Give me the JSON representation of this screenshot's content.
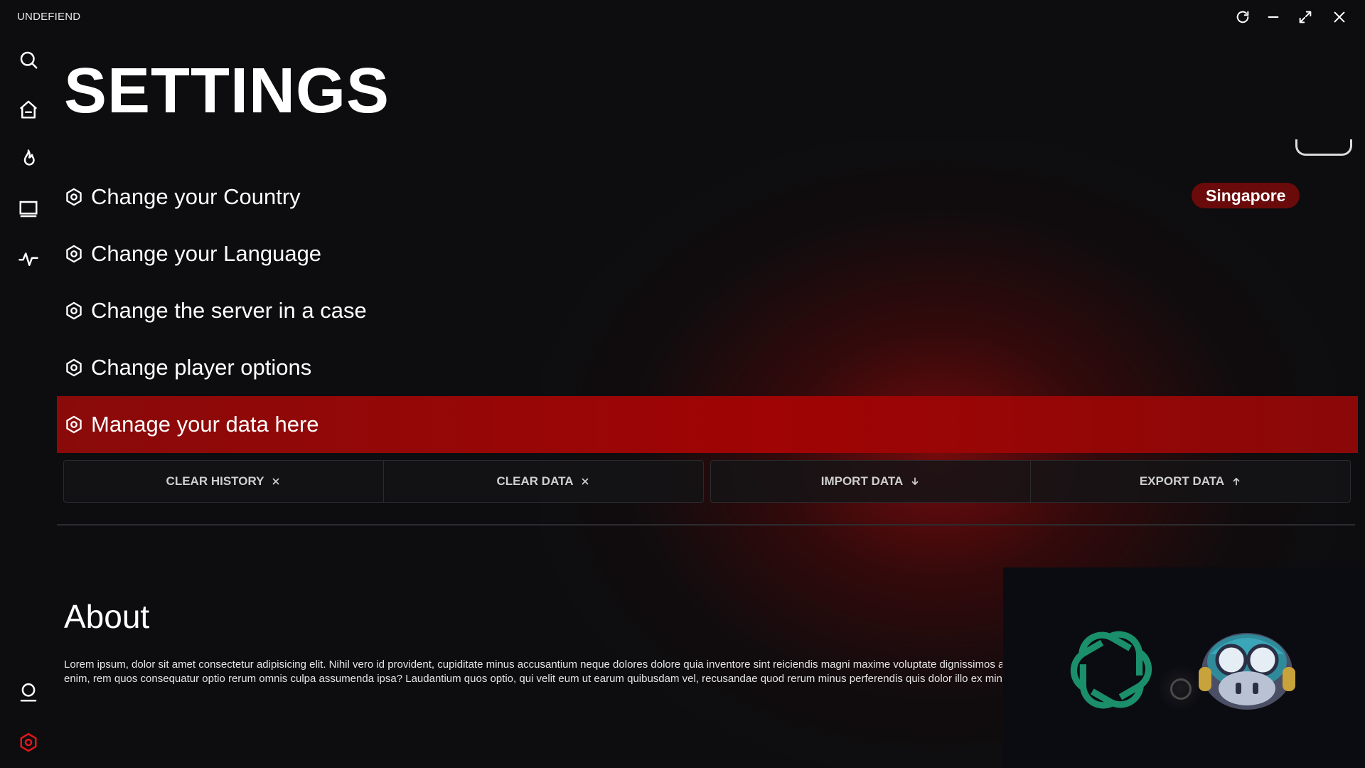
{
  "window": {
    "title": "UNDEFIEND",
    "controls": [
      "refresh-icon",
      "minimize-icon",
      "maximize-icon",
      "close-icon"
    ]
  },
  "sidebar": {
    "items": [
      {
        "icon": "search-icon"
      },
      {
        "icon": "home-icon"
      },
      {
        "icon": "flame-icon"
      },
      {
        "icon": "monitor-icon"
      },
      {
        "icon": "activity-icon"
      }
    ],
    "bottom": [
      {
        "icon": "user-icon"
      },
      {
        "icon": "settings-icon",
        "active": true
      }
    ]
  },
  "page": {
    "title": "SETTINGS"
  },
  "settings": {
    "rows": [
      {
        "label": "Change your Country",
        "value": "Singapore"
      },
      {
        "label": "Change your Language"
      },
      {
        "label": "Change the server in a case"
      },
      {
        "label": "Change player options"
      },
      {
        "label": "Manage your data here",
        "active": true
      }
    ]
  },
  "data_actions": {
    "clear_history": "CLEAR HISTORY",
    "clear_data": "CLEAR DATA",
    "import_data": "IMPORT DATA",
    "export_data": "EXPORT DATA"
  },
  "about": {
    "title": "About",
    "line1": "Lorem ipsum, dolor sit amet consectetur adipisicing elit. Nihil vero id provident, cupiditate minus accusantium neque dolores dolore quia inventore sint reiciendis magni maxime voluptate dignissimos a",
    "line2": "enim, rem quos consequatur optio rerum omnis culpa assumenda ipsa? Laudantium quos optio, qui velit eum ut earum quibusdam vel, recusandae quod rerum minus perferendis quis dolor illo ex min"
  },
  "colors": {
    "accent": "#a00404",
    "badge": "#6a0a0a",
    "background": "#0d0d0f",
    "openai_logo": "#1a8f6a"
  }
}
